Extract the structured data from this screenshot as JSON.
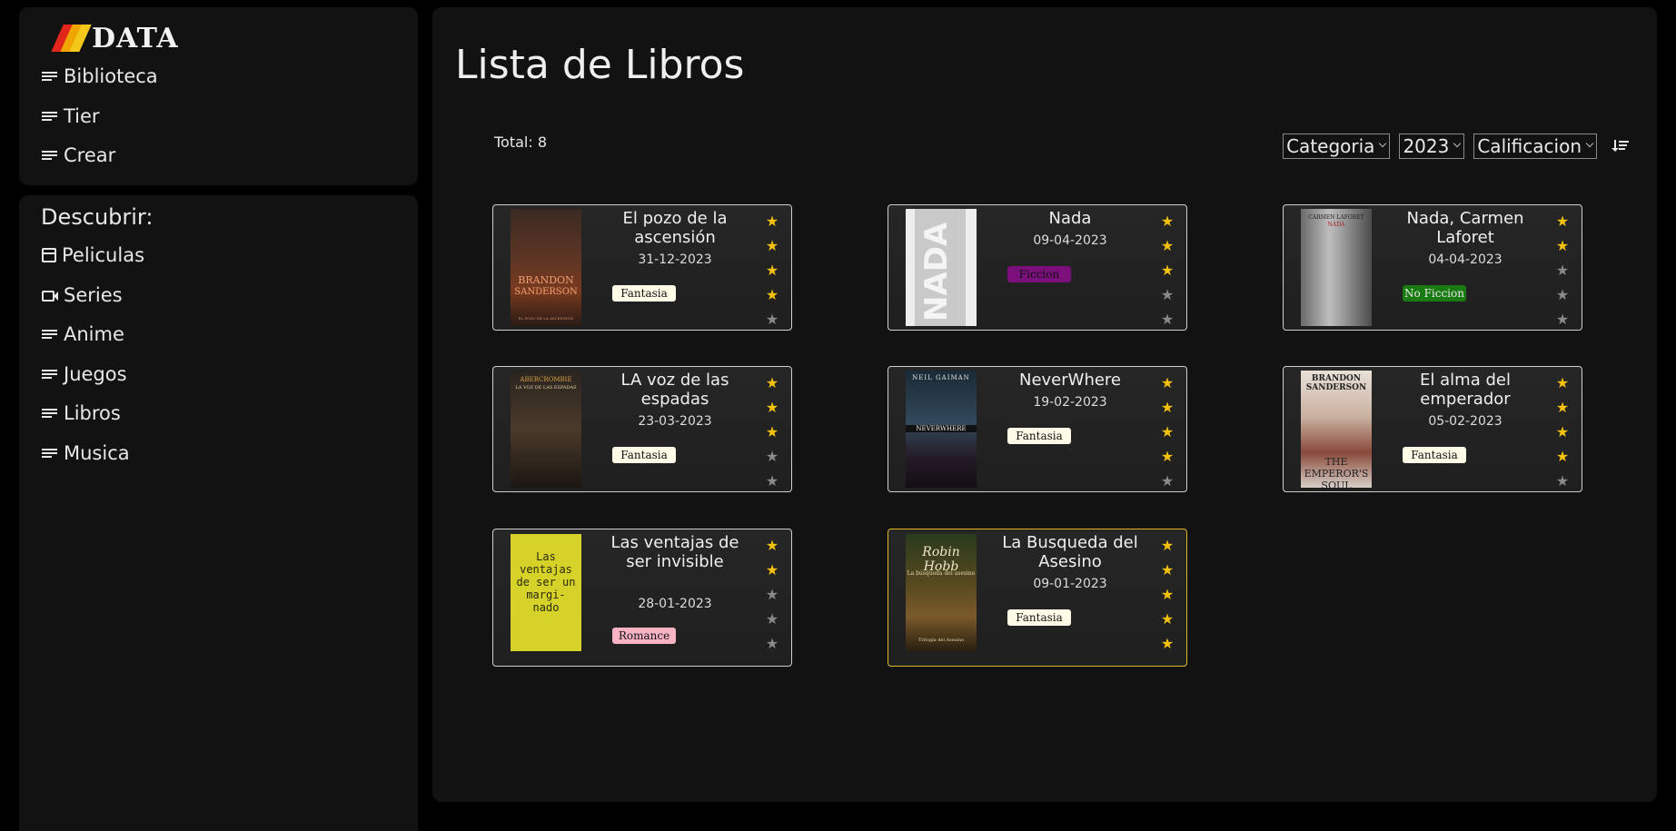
{
  "brand": {
    "name": "DATA"
  },
  "nav": [
    {
      "label": "Biblioteca",
      "icon": "list-icon"
    },
    {
      "label": "Tier",
      "icon": "list-icon"
    },
    {
      "label": "Crear",
      "icon": "list-icon"
    }
  ],
  "discover": {
    "title": "Descubrir:",
    "items": [
      {
        "label": "Peliculas",
        "icon": "clapperboard-icon"
      },
      {
        "label": "Series",
        "icon": "video-camera-icon"
      },
      {
        "label": "Anime",
        "icon": "list-icon"
      },
      {
        "label": "Juegos",
        "icon": "list-icon"
      },
      {
        "label": "Libros",
        "icon": "list-icon"
      },
      {
        "label": "Musica",
        "icon": "list-icon"
      }
    ]
  },
  "main": {
    "title": "Lista de Libros",
    "total": "Total: 8",
    "filters": {
      "category": "Categoria",
      "year": "2023",
      "rating": "Calificacion"
    }
  },
  "colors": {
    "star_on": "#f4c10f",
    "star_off": "#8a8a8a",
    "selected_border": "#e1b820"
  },
  "books": [
    {
      "title": "El pozo de la ascensión",
      "date": "31-12-2023",
      "category": "Fantasia",
      "tag_bg": "#fffbe6",
      "tag_fg": "#111111",
      "rating": 4,
      "cover": {
        "top": "BRANDON",
        "mid": "SANDERSON",
        "bottom": "EL POZO DE LA ASCENSIÓN"
      }
    },
    {
      "title": "Nada",
      "date": "09-04-2023",
      "category": "Ficcion",
      "tag_bg": "#7b0f7b",
      "tag_fg": "#111111",
      "rating": 3,
      "cover": {
        "top": "NADA",
        "mid": "",
        "bottom": ""
      }
    },
    {
      "title": "Nada, Carmen Laforet",
      "date": "04-04-2023",
      "category": "No Ficcion",
      "tag_bg": "#1a7a12",
      "tag_fg": "#e8e8e8",
      "rating": 2,
      "cover": {
        "top": "CARMEN LAFORET",
        "mid": "NADA",
        "bottom": ""
      }
    },
    {
      "title": "LA voz de las espadas",
      "date": "23-03-2023",
      "category": "Fantasia",
      "tag_bg": "#fffbe6",
      "tag_fg": "#111111",
      "rating": 3,
      "cover": {
        "top": "ABERCROMBIE",
        "mid": "LA VOZ DE LAS ESPADAS",
        "bottom": ""
      }
    },
    {
      "title": "NeverWhere",
      "date": "19-02-2023",
      "category": "Fantasia",
      "tag_bg": "#fffbe6",
      "tag_fg": "#111111",
      "rating": 4,
      "cover": {
        "top": "NEIL GAIMAN",
        "mid": "NEVERWHERE",
        "bottom": ""
      }
    },
    {
      "title": "El alma del emperador",
      "date": "05-02-2023",
      "category": "Fantasia",
      "tag_bg": "#fffbe6",
      "tag_fg": "#111111",
      "rating": 4,
      "cover": {
        "top": "BRANDON SANDERSON",
        "mid": "THE EMPEROR'S SOUL",
        "bottom": ""
      }
    },
    {
      "title": "Las ventajas de ser invisible",
      "date": "28-01-2023",
      "category": "Romance",
      "tag_bg": "#f7b3c2",
      "tag_fg": "#111111",
      "rating": 2,
      "cover": {
        "top": "Las ventajas de ser un margi-nado",
        "mid": "",
        "bottom": ""
      }
    },
    {
      "title": "La Busqueda del Asesino",
      "date": "09-01-2023",
      "category": "Fantasia",
      "tag_bg": "#fffbe6",
      "tag_fg": "#111111",
      "rating": 5,
      "cover": {
        "top": "Robin Hobb",
        "mid": "La búsqueda del asesino",
        "bottom": "Trilogía del Asesino"
      }
    }
  ]
}
